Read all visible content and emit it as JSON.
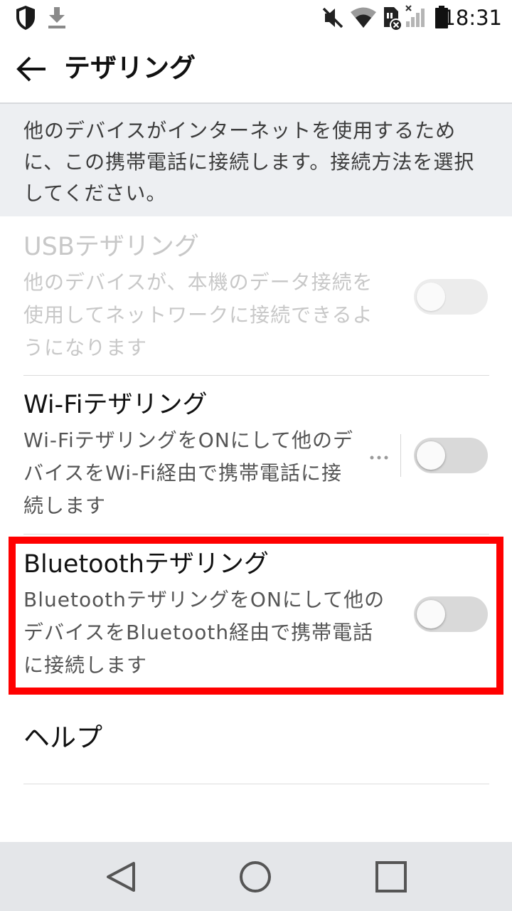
{
  "status_bar": {
    "time": "18:31",
    "icons_left": [
      "shield-icon",
      "download-icon"
    ],
    "icons_right": [
      "mute-icon",
      "wifi-icon",
      "sim-missing-icon",
      "signal-icon",
      "battery-icon"
    ]
  },
  "app_bar": {
    "back_icon": "arrow-left-icon",
    "title": "テザリング"
  },
  "description": "他のデバイスがインターネットを使用するために、この携帯電話に接続します。接続方法を選択してください。",
  "items": [
    {
      "title": "USBテザリング",
      "summary": "他のデバイスが、本機のデータ接続を使用してネットワークに接続できるようになります",
      "enabled": false,
      "checked": false
    },
    {
      "title": "Wi-Fiテザリング",
      "summary": "Wi-FiテザリングをONにして他のデバイスをWi-Fi経由で携帯電話に接続します",
      "enabled": true,
      "checked": false,
      "more_icon": "more-horizontal-icon"
    },
    {
      "title": "Bluetoothテザリング",
      "summary": "BluetoothテザリングをONにして他のデバイスをBluetooth経由で携帯電話に接続します",
      "enabled": true,
      "checked": false
    },
    {
      "title": "ヘルプ"
    }
  ],
  "highlight_color": "#ff0000",
  "nav_bar": {
    "icons": [
      "back-triangle-icon",
      "home-circle-icon",
      "recents-square-icon"
    ]
  }
}
